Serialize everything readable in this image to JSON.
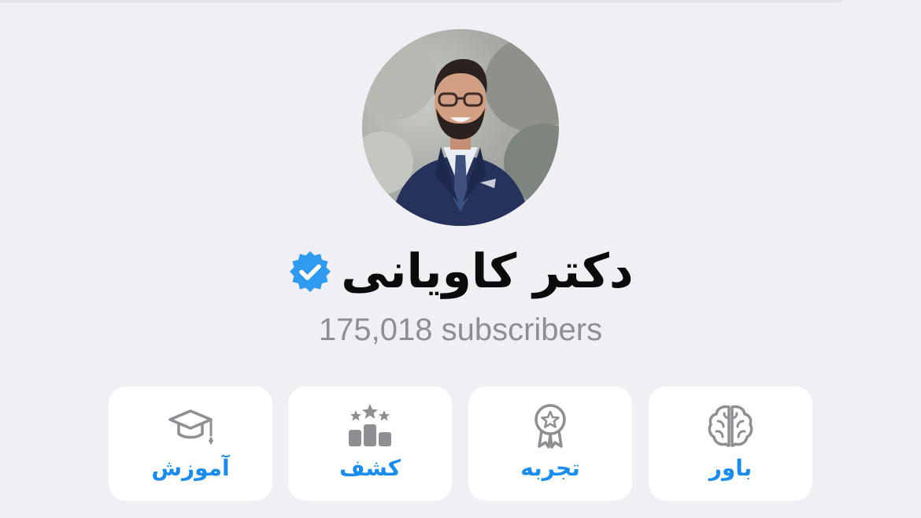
{
  "channel": {
    "name": "دکتر کاویانی",
    "verified_badge_icon": "verified-badge-icon",
    "subscribers_text": "175,018 subscribers"
  },
  "actions": [
    {
      "label": "آموزش",
      "icon": "graduation-cap-icon"
    },
    {
      "label": "کشف",
      "icon": "ranking-stars-icon"
    },
    {
      "label": "تجربه",
      "icon": "award-badge-icon"
    },
    {
      "label": "باور",
      "icon": "brain-icon"
    }
  ],
  "colors": {
    "background": "#efeff4",
    "card": "#ffffff",
    "accent": "#1a8cf0",
    "verified": "#2f9bf0",
    "icon_gray": "#8e8e93",
    "subtext": "#8e8e93"
  }
}
